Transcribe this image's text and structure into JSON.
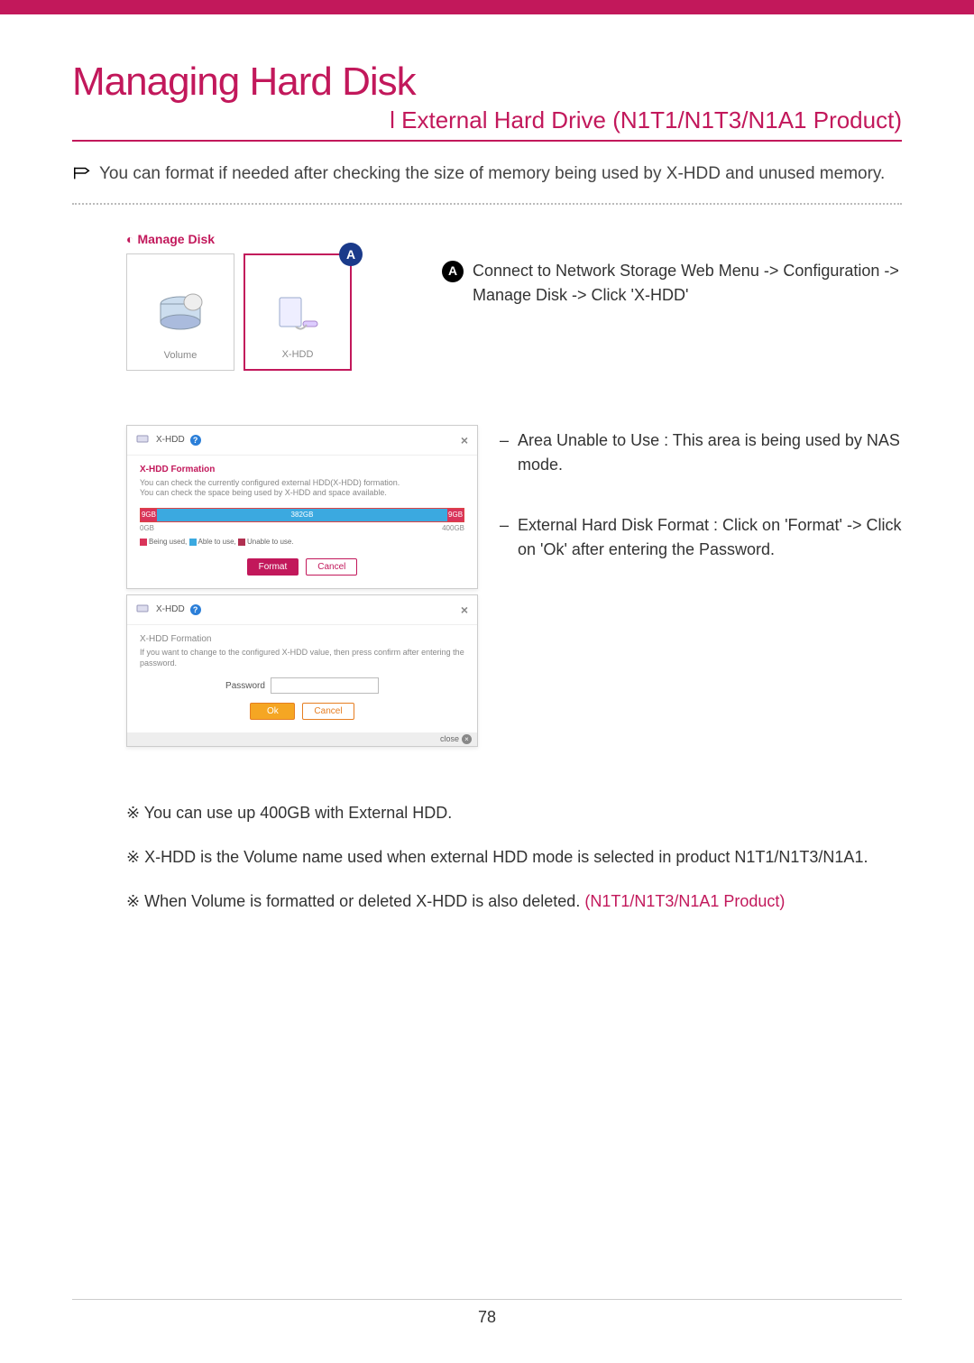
{
  "header": {
    "title": "Managing Hard Disk",
    "subtitle": "l  External Hard Drive (N1T1/N1T3/N1A1 Product)"
  },
  "intro": "You can format if needed after checking the size of memory being used by X-HDD and unused memory.",
  "manage_disk": {
    "label": "Manage Disk",
    "cards": {
      "volume": "Volume",
      "xhdd": "X-HDD"
    },
    "badge": "A"
  },
  "step_a": {
    "letter": "A",
    "text": "Connect to Network Storage Web Menu -> Configuration -> Manage Disk -> Click 'X-HDD'"
  },
  "info": {
    "area_unable": "Area Unable to Use : This area is being used by NAS mode.",
    "format_instr": "External Hard Disk Format : Click on 'Format' -> Click on 'Ok' after entering the Password."
  },
  "dialog1": {
    "title": "X-HDD",
    "section": "X-HDD Formation",
    "desc1": "You can check the currently configured external HDD(X-HDD) formation.",
    "desc2": "You can check the space being used by X-HDD and space available.",
    "bar": {
      "used": "9GB",
      "able": "382GB",
      "unable": "9GB"
    },
    "scale": {
      "min": "0GB",
      "max": "400GB"
    },
    "legend": {
      "used": "Being used,",
      "able": "Able to use,",
      "unable": "Unable to use."
    },
    "buttons": {
      "format": "Format",
      "cancel": "Cancel"
    }
  },
  "dialog2": {
    "title": "X-HDD",
    "section": "X-HDD Formation",
    "desc": "If you want to change to the configured X-HDD value, then press confirm after entering the password.",
    "pw_label": "Password",
    "buttons": {
      "ok": "Ok",
      "cancel": "Cancel"
    },
    "close": "close"
  },
  "notes": {
    "n1": "※ You can use up 400GB with External HDD.",
    "n2": "※ X-HDD is the Volume name used when external HDD mode is selected in product N1T1/N1T3/N1A1.",
    "n3_pre": "※ When Volume is formatted or deleted X-HDD is also deleted. ",
    "n3_pink": "(N1T1/N1T3/N1A1 Product)"
  },
  "pagenum": "78"
}
